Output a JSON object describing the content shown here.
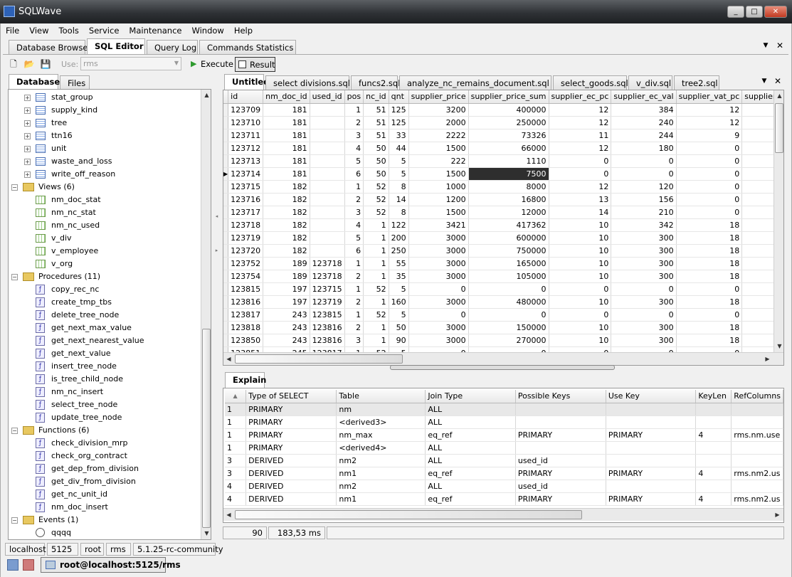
{
  "window": {
    "title": "SQLWave",
    "minimize": "_",
    "maximize": "□",
    "close": "✕"
  },
  "menu": [
    "File",
    "View",
    "Tools",
    "Service",
    "Maintenance",
    "Window",
    "Help"
  ],
  "top_tabs": [
    {
      "label": "Database Browser"
    },
    {
      "label": "SQL Editor"
    },
    {
      "label": "Query Log"
    },
    {
      "label": "Commands Statistics"
    }
  ],
  "toolbar": {
    "use_label": "Use:",
    "use_value": "rms",
    "execute_label": "Execute",
    "result_label": "Result"
  },
  "left_tabs": [
    {
      "label": "Database"
    },
    {
      "label": "Files"
    }
  ],
  "tree": {
    "tables": [
      "stat_group",
      "supply_kind",
      "tree",
      "ttn16",
      "unit",
      "waste_and_loss",
      "write_off_reason"
    ],
    "views_label": "Views (6)",
    "views": [
      "nm_doc_stat",
      "nm_nc_stat",
      "nm_nc_used",
      "v_div",
      "v_employee",
      "v_org"
    ],
    "procedures_label": "Procedures (11)",
    "procedures": [
      "copy_rec_nc",
      "create_tmp_tbs",
      "delete_tree_node",
      "get_next_max_value",
      "get_next_nearest_value",
      "get_next_value",
      "insert_tree_node",
      "is_tree_child_node",
      "nm_nc_insert",
      "select_tree_node",
      "update_tree_node"
    ],
    "functions_label": "Functions (6)",
    "functions": [
      "check_division_mrp",
      "check_org_contract",
      "get_dep_from_division",
      "get_div_from_division",
      "get_nc_unit_id",
      "nm_doc_insert"
    ],
    "events_label": "Events (1)",
    "events": [
      "qqqq"
    ]
  },
  "editor_tabs": [
    {
      "label": "Untitled"
    },
    {
      "label": "select divisions.sql"
    },
    {
      "label": "funcs2.sql"
    },
    {
      "label": "analyze_nc_remains_document.sql"
    },
    {
      "label": "select_goods.sql"
    },
    {
      "label": "v_div.sql"
    },
    {
      "label": "tree2.sql"
    }
  ],
  "result": {
    "columns": [
      "id",
      "nm_doc_id",
      "used_id",
      "pos",
      "nc_id",
      "qnt",
      "supplier_price",
      "supplier_price_sum",
      "supplier_ec_pc",
      "supplier_ec_val",
      "supplier_vat_pc",
      "supplier_vat_val",
      "supplier_a"
    ],
    "rows": [
      [
        "123709",
        "181",
        "",
        "1",
        "51",
        "125",
        "3200",
        "400000",
        "12",
        "384",
        "12",
        "430",
        ""
      ],
      [
        "123710",
        "181",
        "",
        "2",
        "51",
        "125",
        "2000",
        "250000",
        "12",
        "240",
        "12",
        "269",
        ""
      ],
      [
        "123711",
        "181",
        "",
        "3",
        "51",
        "33",
        "2222",
        "73326",
        "11",
        "244",
        "9",
        "222",
        ""
      ],
      [
        "123712",
        "181",
        "",
        "4",
        "50",
        "44",
        "1500",
        "66000",
        "12",
        "180",
        "0",
        "0",
        ""
      ],
      [
        "123713",
        "181",
        "",
        "5",
        "50",
        "5",
        "222",
        "1110",
        "0",
        "0",
        "0",
        "0",
        ""
      ],
      [
        "123714",
        "181",
        "",
        "6",
        "50",
        "5",
        "1500",
        "7500",
        "0",
        "0",
        "0",
        "0",
        ""
      ],
      [
        "123715",
        "182",
        "",
        "1",
        "52",
        "8",
        "1000",
        "8000",
        "12",
        "120",
        "0",
        "0",
        ""
      ],
      [
        "123716",
        "182",
        "",
        "2",
        "52",
        "14",
        "1200",
        "16800",
        "13",
        "156",
        "0",
        "0",
        ""
      ],
      [
        "123717",
        "182",
        "",
        "3",
        "52",
        "8",
        "1500",
        "12000",
        "14",
        "210",
        "0",
        "0",
        ""
      ],
      [
        "123718",
        "182",
        "",
        "4",
        "1",
        "122",
        "3421",
        "417362",
        "10",
        "342",
        "18",
        "677",
        ""
      ],
      [
        "123719",
        "182",
        "",
        "5",
        "1",
        "200",
        "3000",
        "600000",
        "10",
        "300",
        "18",
        "594",
        ""
      ],
      [
        "123720",
        "182",
        "",
        "6",
        "1",
        "250",
        "3000",
        "750000",
        "10",
        "300",
        "18",
        "594",
        ""
      ],
      [
        "123752",
        "189",
        "123718",
        "1",
        "1",
        "55",
        "3000",
        "165000",
        "10",
        "300",
        "18",
        "594",
        ""
      ],
      [
        "123754",
        "189",
        "123718",
        "2",
        "1",
        "35",
        "3000",
        "105000",
        "10",
        "300",
        "18",
        "594",
        ""
      ],
      [
        "123815",
        "197",
        "123715",
        "1",
        "52",
        "5",
        "0",
        "0",
        "0",
        "0",
        "0",
        "0",
        ""
      ],
      [
        "123816",
        "197",
        "123719",
        "2",
        "1",
        "160",
        "3000",
        "480000",
        "10",
        "300",
        "18",
        "594",
        ""
      ],
      [
        "123817",
        "243",
        "123815",
        "1",
        "52",
        "5",
        "0",
        "0",
        "0",
        "0",
        "0",
        "0",
        ""
      ],
      [
        "123818",
        "243",
        "123816",
        "2",
        "1",
        "50",
        "3000",
        "150000",
        "10",
        "300",
        "18",
        "594",
        ""
      ],
      [
        "123850",
        "243",
        "123816",
        "3",
        "1",
        "90",
        "3000",
        "270000",
        "10",
        "300",
        "18",
        "594",
        ""
      ]
    ],
    "partial_row": [
      "123851",
      "245",
      "123817",
      "1",
      "52",
      "5",
      "0",
      "0",
      "0",
      "0",
      "0",
      "0",
      ""
    ]
  },
  "explain": {
    "tab_label": "Explain",
    "sort_glyph": "▲",
    "columns": [
      "Type of SELECT",
      "Table",
      "Join Type",
      "Possible Keys",
      "Use Key",
      "KeyLen",
      "RefColumns"
    ],
    "rows": [
      [
        "1",
        "PRIMARY",
        "nm",
        "ALL",
        "",
        "",
        ""
      ],
      [
        "1",
        "PRIMARY",
        "<derived3>",
        "ALL",
        "",
        "",
        ""
      ],
      [
        "1",
        "PRIMARY",
        "nm_max",
        "eq_ref",
        "PRIMARY",
        "PRIMARY",
        "4",
        "rms.nm.use"
      ],
      [
        "1",
        "PRIMARY",
        "<derived4>",
        "ALL",
        "",
        "",
        ""
      ],
      [
        "3",
        "DERIVED",
        "nm2",
        "ALL",
        "used_id",
        "",
        ""
      ],
      [
        "3",
        "DERIVED",
        "nm1",
        "eq_ref",
        "PRIMARY",
        "PRIMARY",
        "4",
        "rms.nm2.us"
      ],
      [
        "4",
        "DERIVED",
        "nm2",
        "ALL",
        "used_id",
        "",
        ""
      ],
      [
        "4",
        "DERIVED",
        "nm1",
        "eq_ref",
        "PRIMARY",
        "PRIMARY",
        "4",
        "rms.nm2.us"
      ]
    ]
  },
  "result_status": {
    "rows": "90",
    "time": "183,53 ms"
  },
  "status": {
    "host": "localhost",
    "port": "5125",
    "user": "root",
    "db": "rms",
    "version": "5.1.25-rc-community"
  },
  "connection": {
    "label": "root@localhost:5125/rms"
  }
}
